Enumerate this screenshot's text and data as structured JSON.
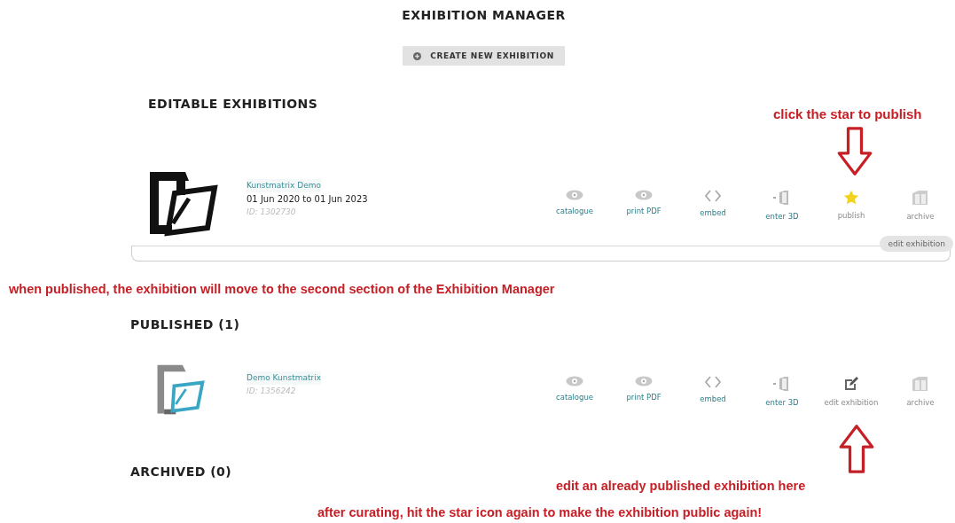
{
  "title": "EXHIBITION MANAGER",
  "create_button": {
    "label": "CREATE NEW EXHIBITION"
  },
  "sections": [
    {
      "heading": "EDITABLE EXHIBITIONS",
      "exhibitions": [
        {
          "name": "Kunstmatrix Demo",
          "dates": "01 Jun 2020 to 01 Jun 2023",
          "id": "ID: 1302730",
          "edit_button": "edit exhibition",
          "actions": [
            {
              "kind": "eye",
              "label": "catalogue"
            },
            {
              "kind": "eye",
              "label": "print PDF"
            },
            {
              "kind": "code",
              "label": "embed"
            },
            {
              "kind": "enter3d",
              "label": "enter 3D"
            },
            {
              "kind": "star",
              "label": "publish"
            },
            {
              "kind": "archive",
              "label": "archive"
            }
          ]
        }
      ]
    },
    {
      "heading": "PUBLISHED (1)",
      "exhibitions": [
        {
          "name": "Demo Kunstmatrix",
          "id": "ID: 1356242",
          "actions": [
            {
              "kind": "eye",
              "label": "catalogue"
            },
            {
              "kind": "eye",
              "label": "print PDF"
            },
            {
              "kind": "code",
              "label": "embed"
            },
            {
              "kind": "enter3d",
              "label": "enter 3D"
            },
            {
              "kind": "edit",
              "label": "edit exhibition"
            },
            {
              "kind": "archive",
              "label": "archive"
            }
          ]
        }
      ]
    },
    {
      "heading": "ARCHIVED (0)"
    }
  ],
  "annotations": [
    {
      "kind": "down-arrow",
      "text": "click the star to publish"
    },
    {
      "kind": "plain",
      "text": "when published, the exhibition will move to the second section of the Exhibition Manager"
    },
    {
      "kind": "up-arrow",
      "text": "edit an already published exhibition here"
    },
    {
      "kind": "plain",
      "text": "after curating, hit the star icon again to make the exhibition public again!"
    }
  ]
}
